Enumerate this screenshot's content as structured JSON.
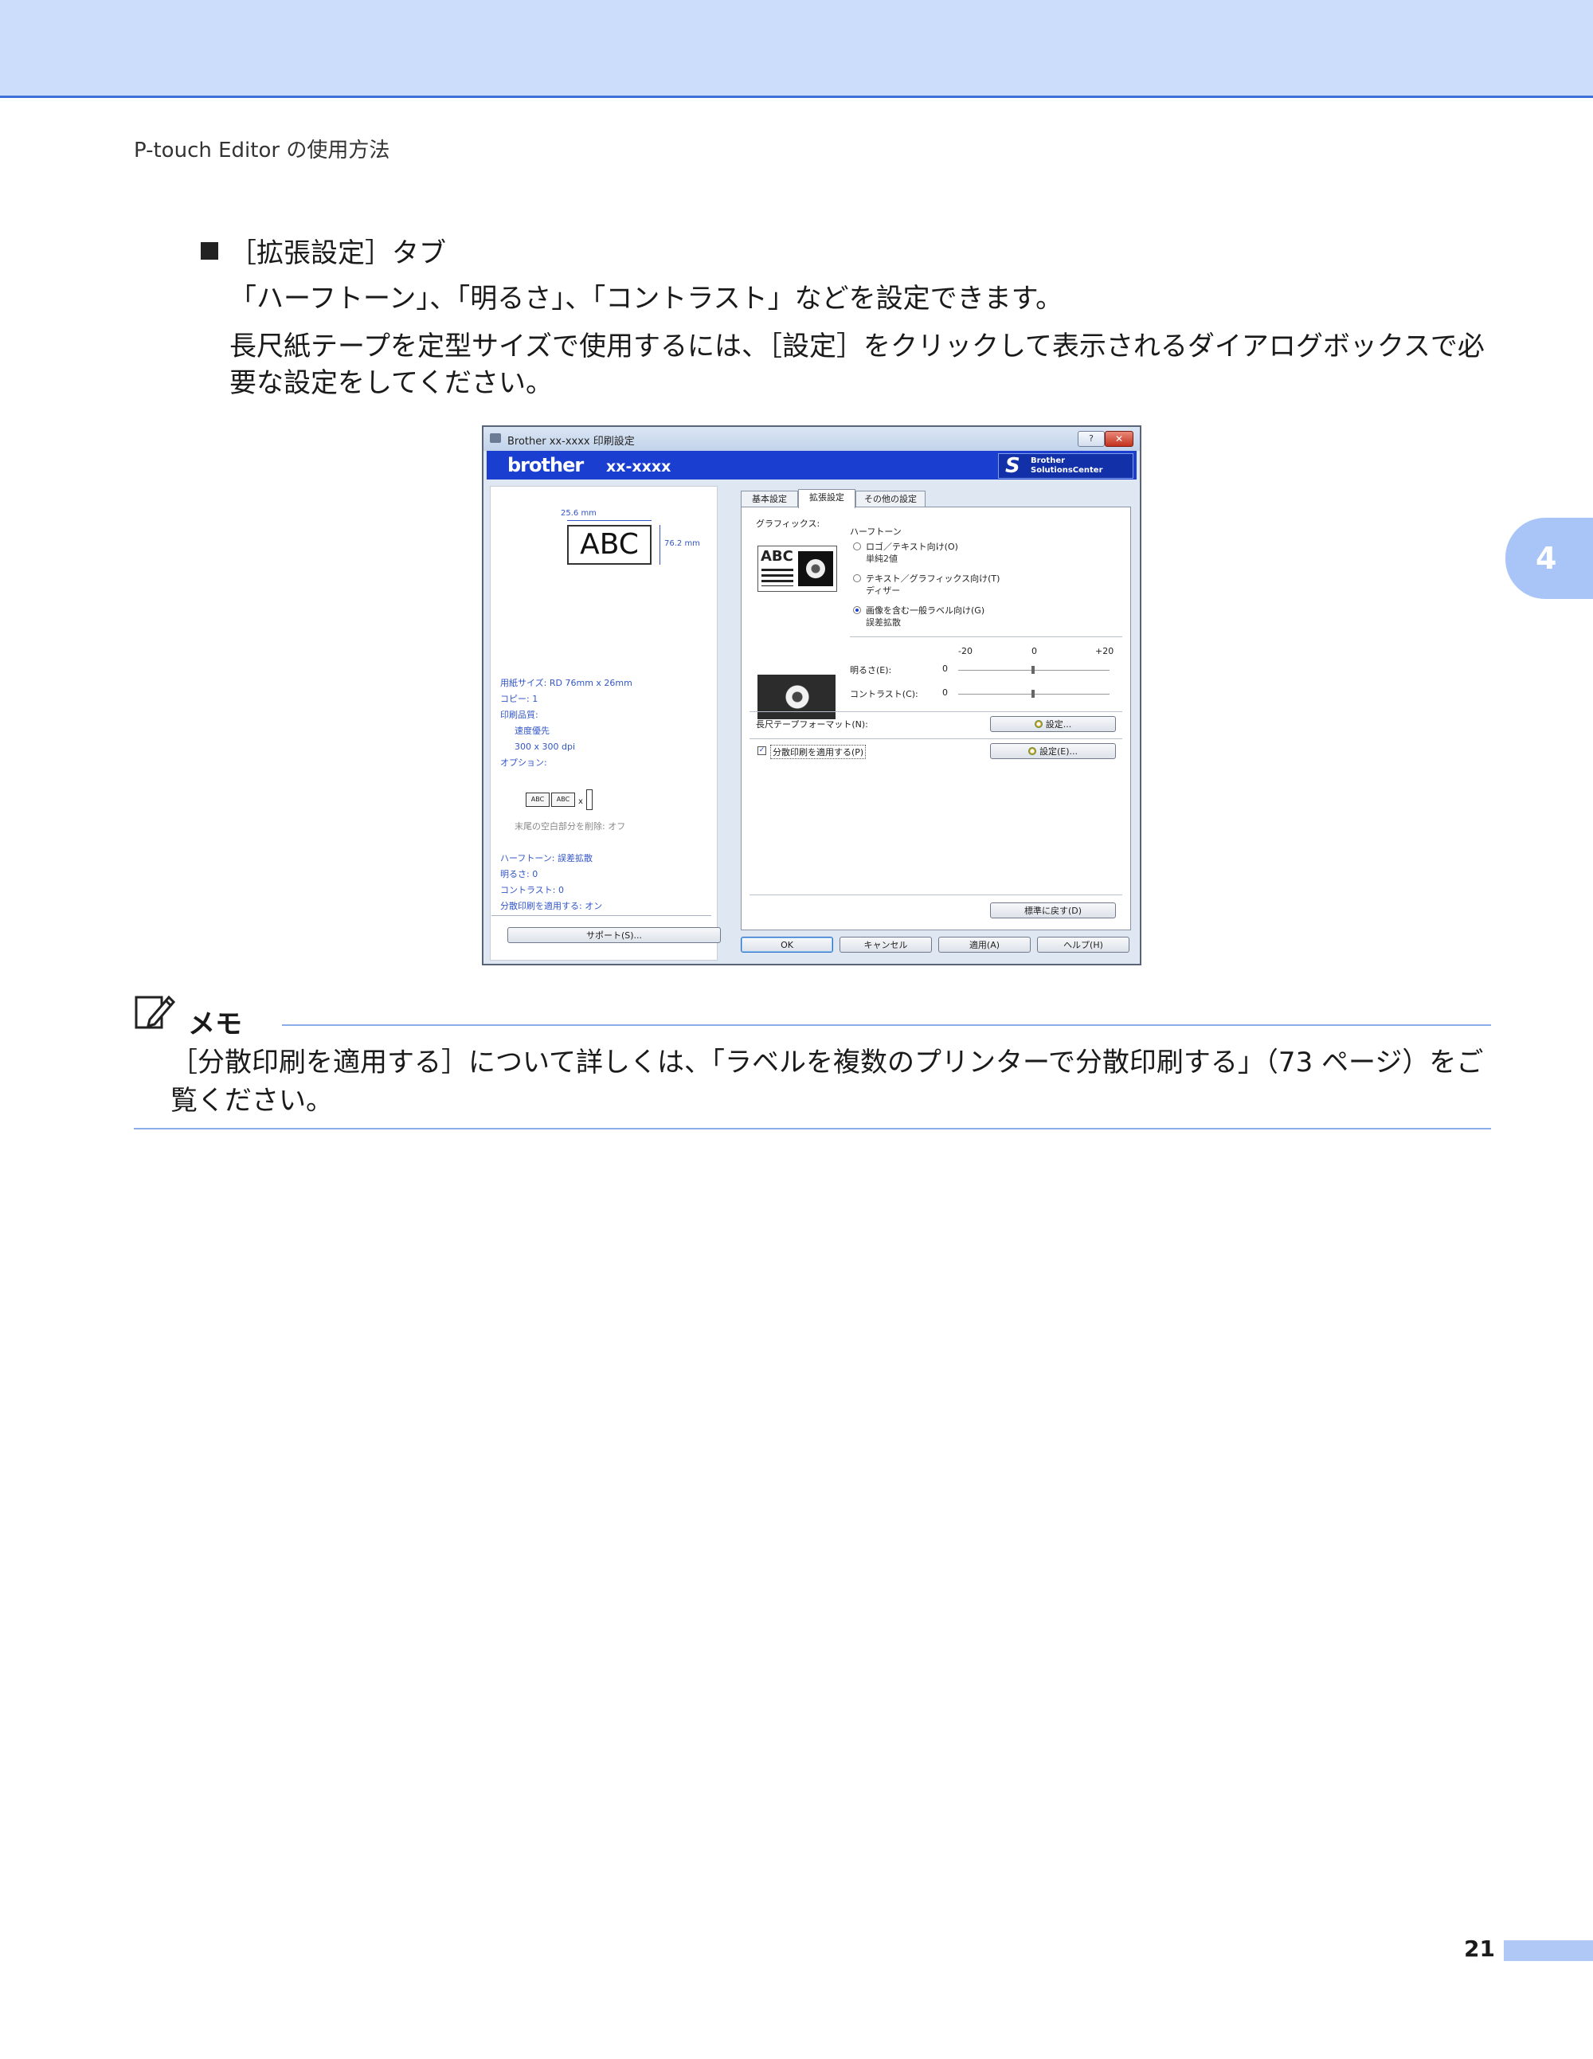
{
  "header": {
    "breadcrumb": "P-touch Editor の使用方法",
    "chapter_number": "4"
  },
  "section": {
    "title": "［拡張設定］タブ",
    "para1": "「ハーフトーン」、「明るさ」、「コントラスト」などを設定できます。",
    "para2": "長尺紙テープを定型サイズで使用するには、［設定］をクリックして表示されるダイアログボックスで必要な設定をしてください。"
  },
  "dialog": {
    "window_title": "Brother  xx-xxxx  印刷設定",
    "help_label": "?",
    "close_label": "✕",
    "brand_logo": "brother",
    "model": "xx-xxxx",
    "solutions_center": {
      "line1": "Brother",
      "line2": "SolutionsCenter"
    },
    "left": {
      "width_dim": "25.6 mm",
      "preview_text": "ABC",
      "height_dim": "76.2 mm",
      "paper_size": "用紙サイズ: RD 76mm x 26mm",
      "copies": "コピー: 1",
      "quality_label": "印刷品質:",
      "quality_value": "速度優先",
      "resolution": "300 x 300 dpi",
      "options_label": "オプション:",
      "opt_box": "ABC",
      "opt_x": "x",
      "trim_tail": "末尾の空白部分を削除: オフ",
      "halftone": "ハーフトーン: 誤差拡散",
      "brightness": "明るさ:   0",
      "contrast": "コントラスト:   0",
      "distributed": "分散印刷を適用する: オン",
      "support_button": "サポート(S)..."
    },
    "tabs": [
      {
        "label": "基本設定"
      },
      {
        "label": "拡張設定"
      },
      {
        "label": "その他の設定"
      }
    ],
    "advanced": {
      "graphics_label": "グラフィックス:",
      "halftone_label": "ハーフトーン",
      "preview_text": "ABC",
      "radios": [
        {
          "label": "ロゴ／テキスト向け(O)",
          "sub": "単純2値",
          "selected": false
        },
        {
          "label": "テキスト／グラフィックス向け(T)",
          "sub": "ディザー",
          "selected": false
        },
        {
          "label": "画像を含む一般ラベル向け(G)",
          "sub": "誤差拡散",
          "selected": true
        }
      ],
      "scale_min": "-20",
      "scale_mid": "0",
      "scale_max": "+20",
      "brightness_label": "明るさ(E):",
      "brightness_value": "0",
      "contrast_label": "コントラスト(C):",
      "contrast_value": "0",
      "long_tape_label": "長尺テープフォーマット(N):",
      "long_tape_button": "設定...",
      "distributed_label": "分散印刷を適用する(P)",
      "distributed_checked": true,
      "distributed_button": "設定(E)...",
      "reset_button": "標準に戻す(D)"
    },
    "buttons": {
      "ok": "OK",
      "cancel": "キャンセル",
      "apply": "適用(A)",
      "help": "ヘルプ(H)"
    }
  },
  "memo": {
    "title": "メモ",
    "text": "［分散印刷を適用する］について詳しくは、「ラベルを複数のプリンターで分散印刷する」（73 ページ）をご覧ください。"
  },
  "footer": {
    "page_number": "21"
  }
}
